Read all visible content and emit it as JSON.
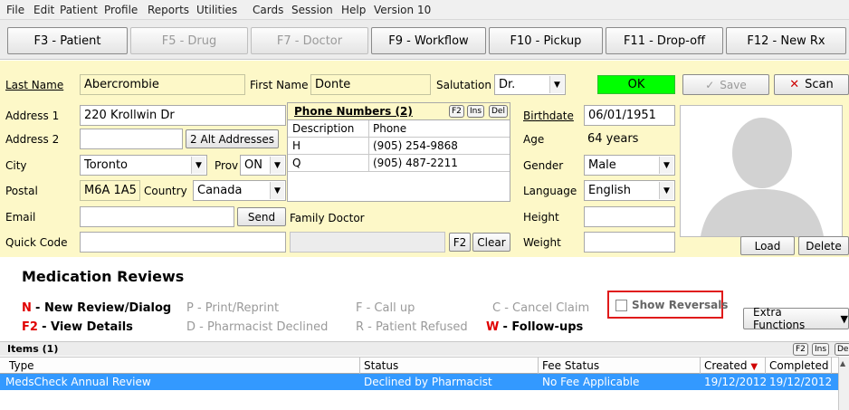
{
  "menu": [
    "File",
    "Edit",
    "Patient",
    "Profile",
    "Reports",
    "Utilities",
    "Cards",
    "Session",
    "Help",
    "Version 10"
  ],
  "toolbar": {
    "patient": "F3 - Patient",
    "drug": "F5 - Drug",
    "doctor": "F7 - Doctor",
    "workflow": "F9 - Workflow",
    "pickup": "F10 - Pickup",
    "dropoff": "F11 - Drop-off",
    "newrx": "F12 - New Rx"
  },
  "form": {
    "last_name_label": "Last Name",
    "last_name": "Abercrombie",
    "first_name_label": "First Name",
    "first_name": "Donte",
    "salutation_label": "Salutation",
    "salutation": "Dr.",
    "status": "OK",
    "save": "Save",
    "scan": "Scan",
    "address1_label": "Address 1",
    "address1": "220 Krollwin Dr",
    "address2_label": "Address 2",
    "alt_addresses": "2 Alt Addresses",
    "city_label": "City",
    "city": "Toronto",
    "prov_label": "Prov",
    "prov": "ON",
    "postal_label": "Postal",
    "postal": "M6A 1A5",
    "country_label": "Country",
    "country": "Canada",
    "email_label": "Email",
    "send": "Send",
    "quick_code_label": "Quick Code",
    "family_doctor_label": "Family Doctor",
    "f2": "F2",
    "clear": "Clear",
    "birthdate_label": "Birthdate",
    "birthdate": "06/01/1951",
    "age_label": "Age",
    "age": "64 years",
    "gender_label": "Gender",
    "gender": "Male",
    "language_label": "Language",
    "language": "English",
    "height_label": "Height",
    "weight_label": "Weight",
    "load": "Load",
    "delete": "Delete"
  },
  "phones": {
    "title": "Phone Numbers (2)",
    "mini": [
      "F2",
      "Ins",
      "Del"
    ],
    "col_description": "Description",
    "col_phone": "Phone",
    "rows": [
      {
        "desc": "H",
        "phone": "(905) 254-9868"
      },
      {
        "desc": "Q",
        "phone": "(905) 487-2211"
      }
    ]
  },
  "reviews": {
    "title": "Medication Reviews",
    "n_key": "N",
    "n_label": "- New Review/Dialog",
    "p_label": "P - Print/Reprint",
    "f_label": "F - Call up",
    "c_label": "C - Cancel Claim",
    "show_reversals": "Show Reversals",
    "extra_functions": "Extra Functions",
    "f2_key": "F2",
    "f2_label": "- View Details",
    "d_label": "D - Pharmacist Declined",
    "r_label": "R - Patient Refused",
    "w_key": "W",
    "w_label": "- Follow-ups",
    "items": "Items (1)",
    "items_mini": [
      "F2",
      "Ins",
      "De"
    ],
    "columns": [
      "Type",
      "Status",
      "Fee Status",
      "Created",
      "Completed"
    ],
    "rows": [
      {
        "type": "MedsCheck Annual Review",
        "status": "Declined by Pharmacist",
        "fee": "No Fee Applicable",
        "created": "19/12/2012",
        "completed": "19/12/2012"
      }
    ]
  },
  "colors": {
    "form_bg": "#fdf8c8",
    "ok_green": "#00ff00",
    "selection": "#3399ff",
    "highlight_red": "#e01a1a"
  }
}
